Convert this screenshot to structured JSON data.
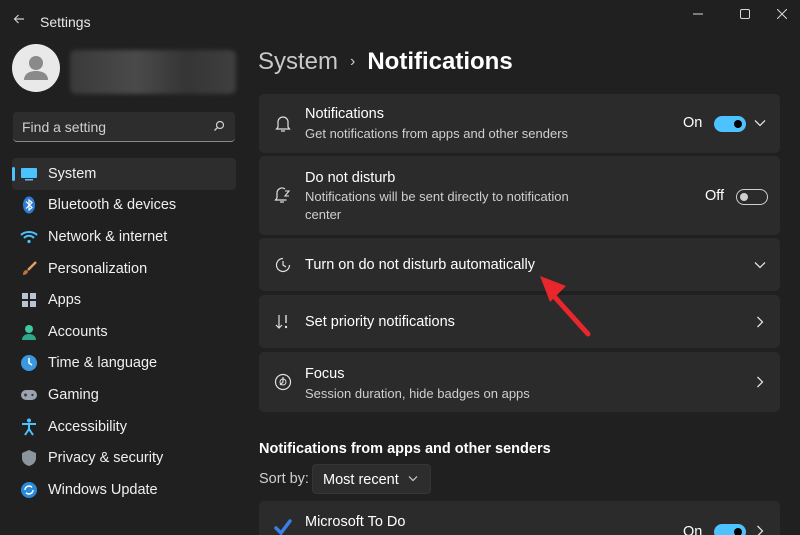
{
  "window": {
    "title": "Settings",
    "controls": {
      "minimize": "minimize-icon",
      "maximize": "maximize-icon",
      "close": "close-icon"
    }
  },
  "search": {
    "placeholder": "Find a setting"
  },
  "sidebar": {
    "items": [
      {
        "label": "System",
        "icon": "system-icon",
        "active": true
      },
      {
        "label": "Bluetooth & devices",
        "icon": "bluetooth-icon"
      },
      {
        "label": "Network & internet",
        "icon": "network-icon"
      },
      {
        "label": "Personalization",
        "icon": "brush-icon"
      },
      {
        "label": "Apps",
        "icon": "apps-icon"
      },
      {
        "label": "Accounts",
        "icon": "accounts-icon"
      },
      {
        "label": "Time & language",
        "icon": "time-language-icon"
      },
      {
        "label": "Gaming",
        "icon": "gaming-icon"
      },
      {
        "label": "Accessibility",
        "icon": "accessibility-icon"
      },
      {
        "label": "Privacy & security",
        "icon": "shield-icon"
      },
      {
        "label": "Windows Update",
        "icon": "windows-update-icon"
      }
    ]
  },
  "breadcrumb": {
    "parent": "System",
    "separator": "›",
    "current": "Notifications"
  },
  "cards": {
    "notifications": {
      "title": "Notifications",
      "subtitle": "Get notifications from apps and other senders",
      "toggle_label": "On",
      "toggle_state": true
    },
    "dnd": {
      "title": "Do not disturb",
      "subtitle_line1": "Notifications will be sent directly to notification",
      "subtitle_line2": "center",
      "toggle_label": "Off",
      "toggle_state": false
    },
    "dnd_auto": {
      "title": "Turn on do not disturb automatically"
    },
    "priority": {
      "title": "Set priority notifications"
    },
    "focus": {
      "title": "Focus",
      "subtitle": "Session duration, hide badges on apps"
    }
  },
  "apps_section": {
    "title": "Notifications from apps and other senders",
    "sort_label": "Sort by:",
    "sort_value": "Most recent",
    "apps": [
      {
        "name": "Microsoft To Do",
        "toggle_label": "On",
        "toggle_state": true
      }
    ]
  },
  "colors": {
    "accent": "#4cc2ff",
    "background": "#202020",
    "card": "#2b2b2b",
    "annotation_arrow": "#e8262c"
  }
}
